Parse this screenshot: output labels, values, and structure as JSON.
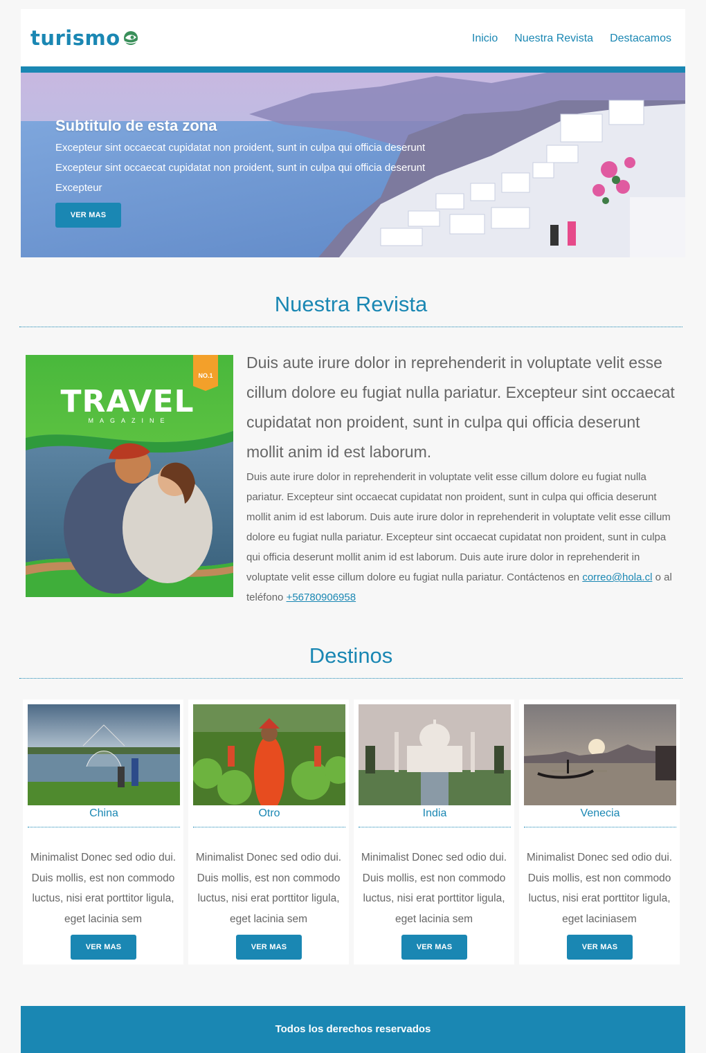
{
  "header": {
    "logo_text": "turismo",
    "nav": [
      "Inicio",
      "Nuestra Revista",
      "Destacamos"
    ]
  },
  "hero": {
    "title": "Subtitulo de esta zona",
    "text": "Excepteur sint occaecat cupidatat non proident, sunt in culpa qui officia deserunt Excepteur sint occaecat cupidatat non proident, sunt in culpa qui officia deserunt Excepteur",
    "button": "VER MAS"
  },
  "magazine": {
    "section_title": "Nuestra Revista",
    "cover_title": "TRAVEL",
    "cover_subtitle": "MAGAZINE",
    "cover_badge": "NO.1",
    "lead": "Duis aute irure dolor in reprehenderit in voluptate velit esse cillum dolore eu fugiat nulla pariatur. Excepteur sint occaecat cupidatat non proident, sunt in culpa qui officia deserunt mollit anim id est laborum.",
    "body": "Duis aute irure dolor in reprehenderit in voluptate velit esse cillum dolore eu fugiat nulla pariatur. Excepteur sint occaecat cupidatat non proident, sunt in culpa qui officia deserunt mollit anim id est laborum. Duis aute irure dolor in reprehenderit in voluptate velit esse cillum dolore eu fugiat nulla pariatur. Excepteur sint occaecat cupidatat non proident, sunt in culpa qui officia deserunt mollit anim id est laborum. Duis aute irure dolor in reprehenderit in voluptate velit esse cillum dolore eu fugiat nulla pariatur.",
    "contact_prefix": "Contáctenos en",
    "email": "correo@hola.cl",
    "contact_middle": "o al teléfono",
    "phone": "+56780906958"
  },
  "destinations": {
    "section_title": "Destinos",
    "cards": [
      {
        "name": "China",
        "desc": "Minimalist Donec sed odio dui. Duis mollis, est non commodo luctus, nisi erat porttitor ligula, eget lacinia sem",
        "button": "VER MAS"
      },
      {
        "name": "Otro",
        "desc": "Minimalist Donec sed odio dui. Duis mollis, est non commodo luctus, nisi erat porttitor ligula, eget lacinia sem",
        "button": "VER MAS"
      },
      {
        "name": "India",
        "desc": "Minimalist Donec sed odio dui. Duis mollis, est non commodo luctus, nisi erat porttitor ligula, eget lacinia sem",
        "button": "VER MAS"
      },
      {
        "name": "Venecia",
        "desc": "Minimalist Donec sed odio dui. Duis mollis, est non commodo luctus, nisi erat porttitor ligula, eget laciniasem",
        "button": "VER MAS"
      }
    ]
  },
  "footer": {
    "text": "Todos los derechos reservados"
  },
  "colors": {
    "accent": "#1a87b3",
    "text": "#666666",
    "background": "#f7f7f7"
  }
}
